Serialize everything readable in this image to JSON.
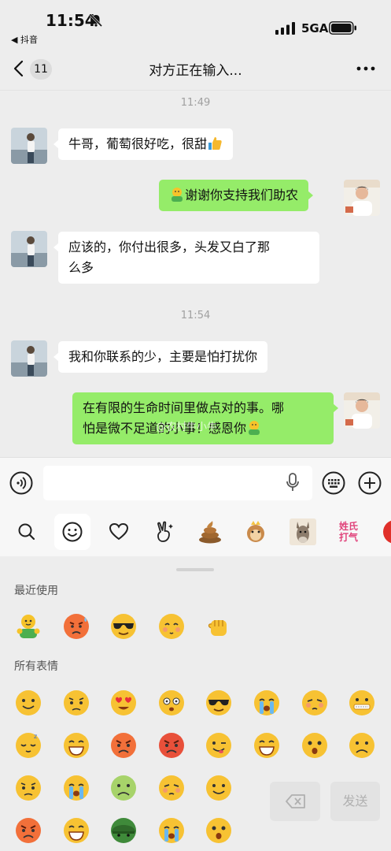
{
  "status_bar": {
    "time": "11:54",
    "back_app": "◀ 抖音",
    "network": "5GA"
  },
  "nav": {
    "badge": "11",
    "title": "对方正在输入..."
  },
  "chat": {
    "timestamps": [
      "11:49",
      "11:54"
    ],
    "messages": [
      {
        "side": "left",
        "text": "牛哥，葡萄很好吃，很甜",
        "emoji": "thumbs-up"
      },
      {
        "side": "right",
        "text": "谢谢你支持我们助农",
        "emoji": "hug"
      },
      {
        "side": "left",
        "text_line1": "应该的，你付出很多，头发又白了那",
        "text_line2": "么多"
      },
      {
        "side": "left",
        "text": "我和你联系的少，主要是怕打扰你"
      },
      {
        "side": "right",
        "text_line1": "在有限的生命时间里做点对的事。哪",
        "text_line2": "怕是微不足道的小事！感恩你",
        "emoji": "hug"
      }
    ],
    "watermark": "@农村牛小牛"
  },
  "emoji_panel": {
    "recent_title": "最近使用",
    "all_title": "所有表情",
    "sticker_text_line1": "姓氏",
    "sticker_text_line2": "打气",
    "send_label": "发送"
  },
  "colors": {
    "bubble_right": "#95ec69",
    "bubble_left": "#ffffff",
    "background": "#ededed"
  }
}
